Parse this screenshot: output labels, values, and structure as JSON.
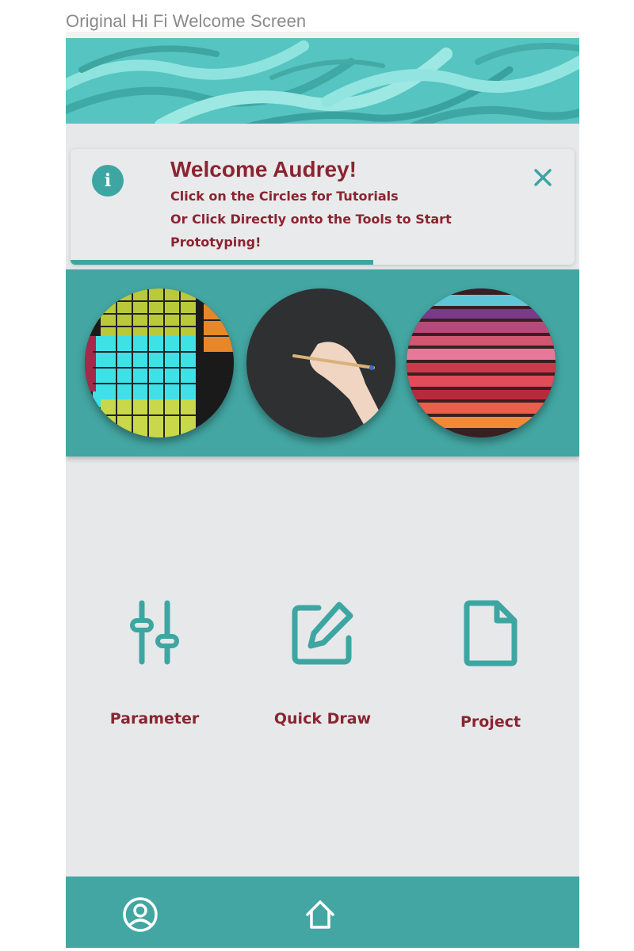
{
  "caption": "Original Hi Fi Welcome Screen",
  "welcome": {
    "title": "Welcome Audrey!",
    "line1": "Click on the Circles for Tutorials",
    "line2": "Or Click Directly onto the Tools to Start",
    "line3": "Prototyping!",
    "info_icon": "info-icon",
    "close_icon": "close-icon",
    "progress": 0.6
  },
  "tutorials": [
    {
      "name": "tutorial-circle-building-lights"
    },
    {
      "name": "tutorial-circle-hand-drawing"
    },
    {
      "name": "tutorial-circle-color-stack"
    }
  ],
  "tools": [
    {
      "label": "Parameter",
      "icon": "sliders-icon"
    },
    {
      "label": "Quick Draw",
      "icon": "edit-icon"
    },
    {
      "label": "Project",
      "icon": "document-icon"
    }
  ],
  "nav": {
    "profile_icon": "user-circle-icon",
    "home_icon": "home-icon"
  },
  "colors": {
    "accent": "#43a6a2",
    "text_dark_red": "#8b2430",
    "background": "#e7e8ea"
  }
}
